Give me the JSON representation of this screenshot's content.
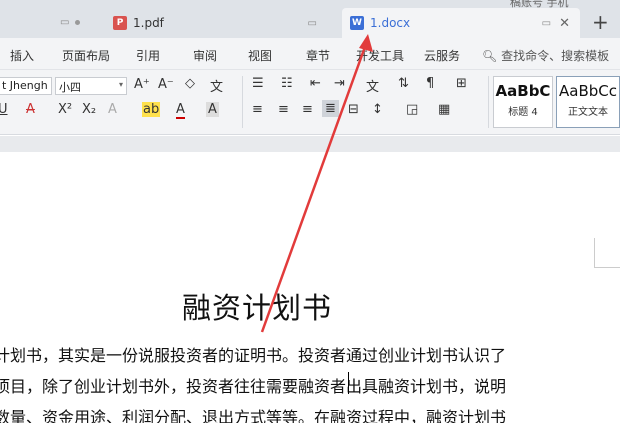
{
  "tabs": {
    "left_mini": "",
    "pdf_name": "1.pdf",
    "docx_name": "1.docx",
    "plus": "+",
    "clipped_top": "稿账号 手机"
  },
  "menu": [
    "插入",
    "页面布局",
    "引用",
    "审阅",
    "视图",
    "章节",
    "开发工具",
    "云服务"
  ],
  "search_label": "查找命令、搜索模板",
  "ribbon": {
    "font_name": "t Jhengh",
    "font_size": "小四",
    "styles": [
      {
        "preview": "AaBbC",
        "name": "标题 4"
      },
      {
        "preview": "AaBbCc",
        "name": "正文文本"
      }
    ]
  },
  "document": {
    "title": "融资计划书",
    "lines": [
      "计划书，其实是一份说服投资者的证明书。投资者通过创业计划书认识了",
      "项目，除了创业计划书外，投资者往往需要融资者出具融资计划书，说明",
      "数量、资金用途、利润分配、退出方式等等。在融资过程中，融资计划书"
    ]
  },
  "colors": {
    "tabbar": "#dfe3e8",
    "active_tab": "#3b6fd6",
    "arrow": "#e23b3b"
  }
}
